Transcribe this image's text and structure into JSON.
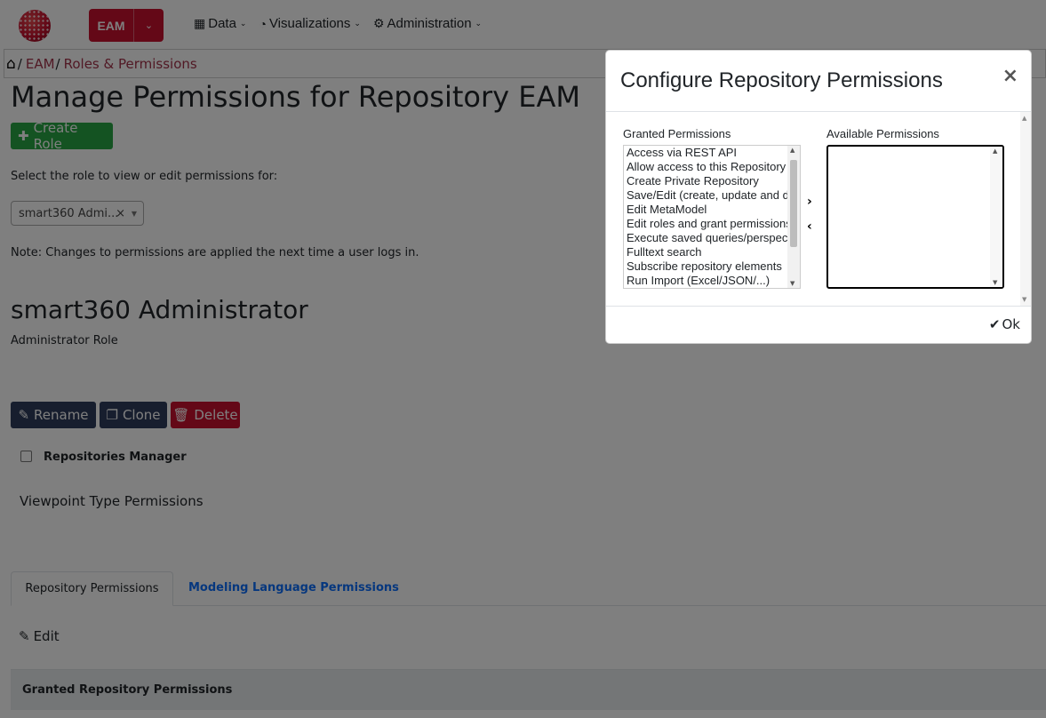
{
  "navbar": {
    "repo_label": "EAM",
    "menu": [
      {
        "label": "Data",
        "icon": "sitemap-icon"
      },
      {
        "label": "Visualizations",
        "icon": "pie-chart-icon"
      },
      {
        "label": "Administration",
        "icon": "gears-icon"
      }
    ]
  },
  "breadcrumb": {
    "items": [
      "EAM",
      "Roles & Permissions"
    ]
  },
  "page": {
    "title": "Manage Permissions for Repository EAM",
    "create_role": "Create Role",
    "select_label": "Select the role to view or edit permissions for:",
    "selected_role": "smart360 Admi...",
    "note": "Note: Changes to permissions are applied the next time a user logs in.",
    "role_name": "smart360 Administrator",
    "role_desc": "Administrator Role",
    "rename": "Rename",
    "clone": "Clone",
    "delete": "Delete",
    "repo_manager": "Repositories Manager",
    "viewpoint_title": "Viewpoint Type Permissions",
    "tabs": [
      "Repository Permissions",
      "Modeling Language Permissions"
    ],
    "edit": "Edit",
    "granted_header": "Granted Repository Permissions"
  },
  "modal": {
    "title": "Configure Repository Permissions",
    "close": "×",
    "granted_label": "Granted Permissions",
    "available_label": "Available Permissions",
    "granted": [
      "Access via REST API",
      "Allow access to this Repository",
      "Create Private Repository",
      "Save/Edit (create, update and d",
      "Edit MetaModel",
      "Edit roles and grant permissions",
      "Execute saved queries/perspec",
      "Fulltext search",
      "Subscribe repository elements",
      "Run Import (Excel/JSON/...)"
    ],
    "available": [],
    "ok": "Ok"
  },
  "colors": {
    "brand": "#c8102e",
    "success": "#28a745",
    "dark": "#2e3d5c",
    "link": "#0d6efd",
    "breadcrumb": "#a3334a"
  }
}
